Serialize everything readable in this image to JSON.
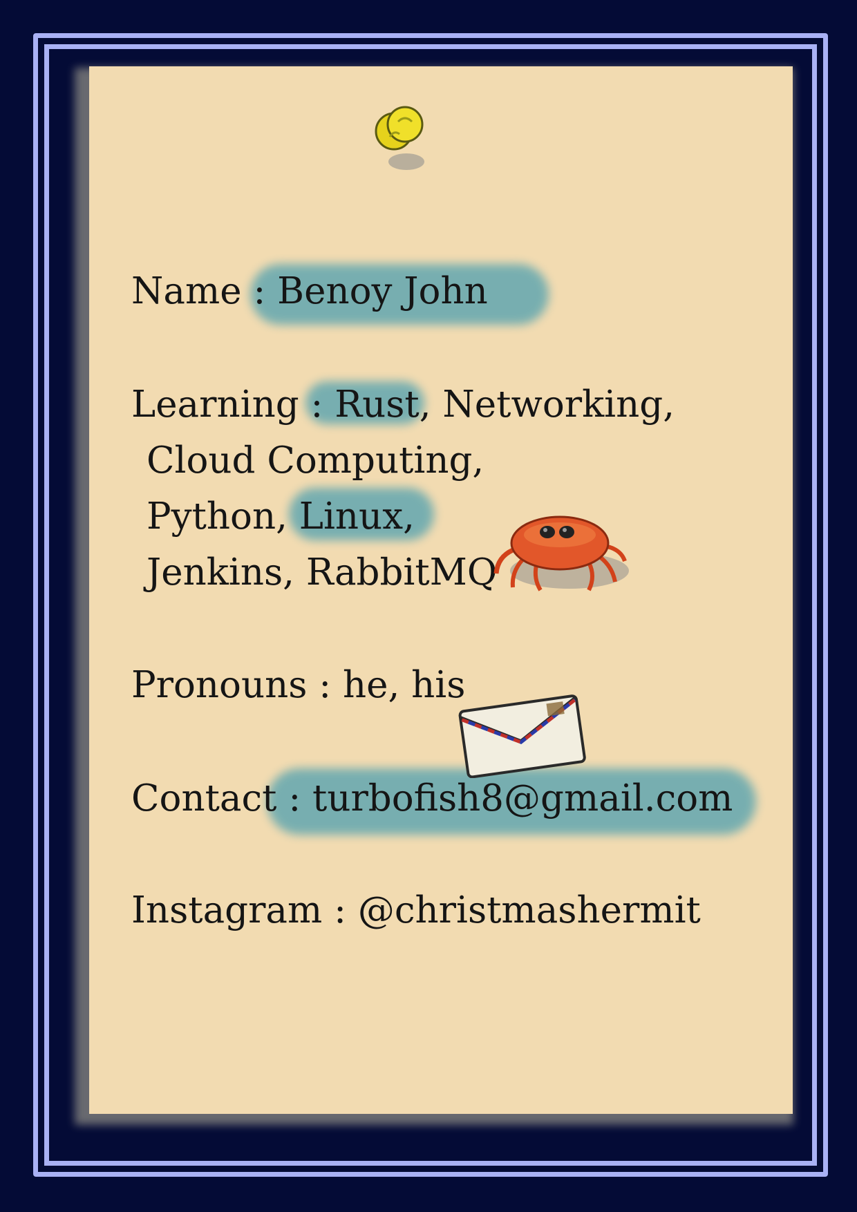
{
  "profile": {
    "name_line": "Name : Benoy John",
    "learning_line_1": "Learning : Rust, Networking,",
    "learning_line_2": "Cloud Computing,",
    "learning_line_3": "Python, Linux,",
    "learning_line_4": "Jenkins, RabbitMQ",
    "pronouns_line": "Pronouns : he, his",
    "contact_line": "Contact : turbofish8@gmail.com",
    "instagram_line": "Instagram : @christmashermit"
  },
  "colors": {
    "background": "#040b36",
    "frame": "#a9b1f5",
    "paper": "#f2dbb1",
    "highlight_wash": "#6aaab0",
    "text": "#151515"
  },
  "icons": {
    "pin": "pushpin-icon",
    "crab": "crab-icon",
    "envelope": "envelope-icon"
  }
}
